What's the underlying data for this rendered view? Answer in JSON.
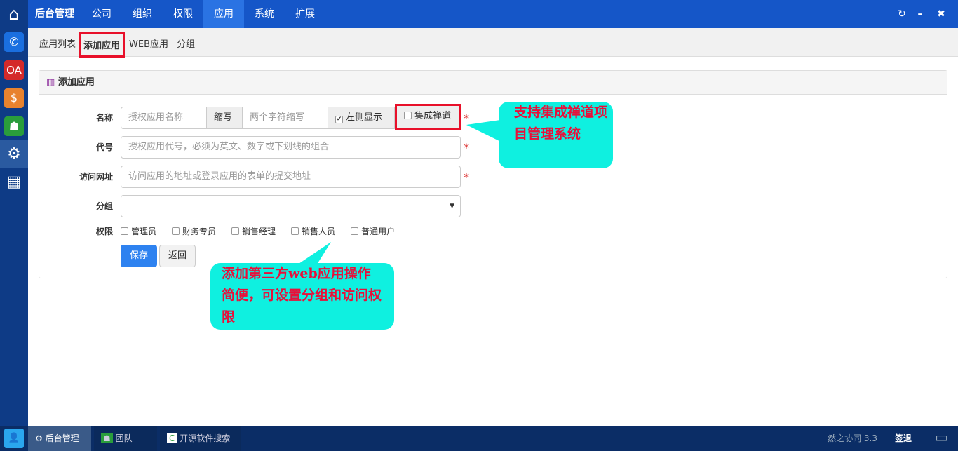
{
  "topnav": {
    "brand": "后台管理",
    "items": [
      "公司",
      "组织",
      "权限",
      "应用",
      "系统",
      "扩展"
    ],
    "active": "应用"
  },
  "subnav": [
    "应用列表",
    "添加应用",
    "WEB应用",
    "分组"
  ],
  "panel": {
    "title": "添加应用",
    "name_label": "名称",
    "name_placeholder": "授权应用名称",
    "abbr_label": "缩写",
    "abbr_placeholder": "两个字符缩写",
    "left_show": "左侧显示",
    "zentao": "集成禅道",
    "code_label": "代号",
    "code_placeholder": "授权应用代号，必须为英文、数字或下划线的组合",
    "url_label": "访问网址",
    "url_placeholder": "访问应用的地址或登录应用的表单的提交地址",
    "group_label": "分组",
    "perm_label": "权限",
    "perms": [
      "管理员",
      "财务专员",
      "销售经理",
      "销售人员",
      "普通用户"
    ],
    "save": "保存",
    "back": "返回",
    "required": "*"
  },
  "callouts": {
    "zentao": "支持集成禅道项目管理系统",
    "web": "添加第三方web应用操作简便，可设置分组和访问权限"
  },
  "taskbar": {
    "items": [
      "后台管理",
      "团队",
      "开源软件搜索"
    ],
    "version": "然之协同 3.3",
    "signout": "签退"
  },
  "sidebar": {
    "oa": "OA"
  }
}
